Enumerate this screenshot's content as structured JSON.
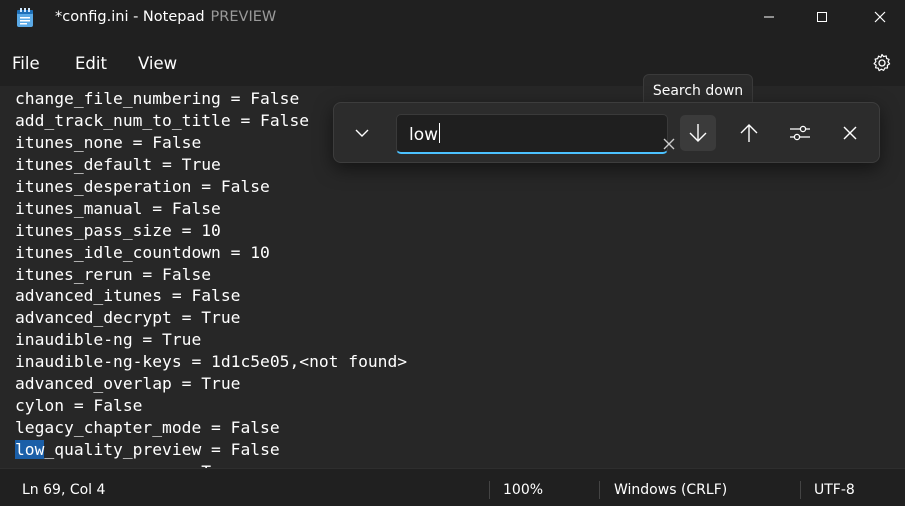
{
  "window": {
    "title": "*config.ini - Notepad",
    "badge": "PREVIEW"
  },
  "menu": {
    "file": "File",
    "edit": "Edit",
    "view": "View"
  },
  "editor": {
    "lines": [
      "change_file_numbering = False",
      "add_track_num_to_title = False",
      "itunes_none = False",
      "itunes_default = True",
      "itunes_desperation = False",
      "itunes_manual = False",
      "itunes_pass_size = 10",
      "itunes_idle_countdown = 10",
      "itunes_rerun = False",
      "advanced_itunes = False",
      "advanced_decrypt = True",
      "inaudible-ng = True",
      "inaudible-ng-keys = 1d1c5e05,<not found>",
      "advanced_overlap = True",
      "cylon = False",
      "legacy_chapter_mode = False"
    ],
    "highlight_line": {
      "match": "low",
      "rest": "_quality_preview = False"
    },
    "partial_line": "                 = True"
  },
  "find": {
    "query": "low",
    "tooltip": "Search down"
  },
  "status": {
    "position": "Ln 69, Col 4",
    "zoom": "100%",
    "line_endings": "Windows (CRLF)",
    "encoding": "UTF-8"
  },
  "colors": {
    "accent": "#4cc2ff",
    "selection": "#1b5fa8",
    "editor_bg": "#272727"
  }
}
